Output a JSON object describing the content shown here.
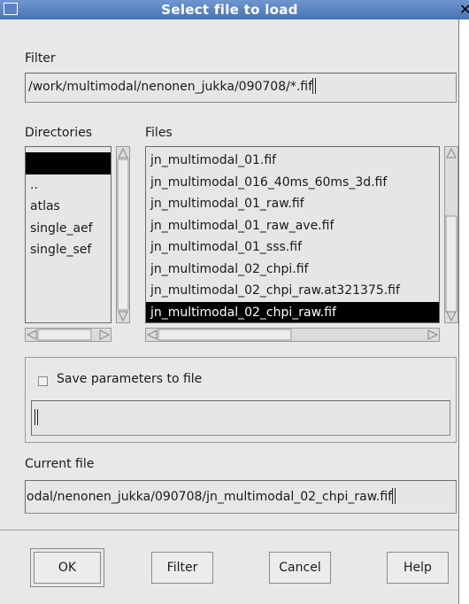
{
  "window": {
    "title": "Select file to load",
    "close_glyph": "✕"
  },
  "filter": {
    "label": "Filter",
    "value": "/work/multimodal/nenonen_jukka/090708/*.fif"
  },
  "directories": {
    "label": "Directories",
    "items": [
      "",
      "..",
      "atlas",
      "single_aef",
      "single_sef"
    ],
    "selected_index": 0
  },
  "files": {
    "label": "Files",
    "items": [
      "jn_multimodal_01.fif",
      "jn_multimodal_016_40ms_60ms_3d.fif",
      "jn_multimodal_01_raw.fif",
      "jn_multimodal_01_raw_ave.fif",
      "jn_multimodal_01_sss.fif",
      "jn_multimodal_02_chpi.fif",
      "jn_multimodal_02_chpi_raw.at321375.fif",
      "jn_multimodal_02_chpi_raw.fif"
    ],
    "selected_index": 7
  },
  "save_params": {
    "label": "Save parameters to file",
    "checked": false,
    "value": ""
  },
  "current_file": {
    "label": "Current file",
    "value": "odal/nenonen_jukka/090708/jn_multimodal_02_chpi_raw.fif"
  },
  "buttons": {
    "ok": "OK",
    "filter": "Filter",
    "cancel": "Cancel",
    "help": "Help"
  },
  "icons": {
    "check": "checkbox-icon",
    "arrows": "scroll-arrow-icon"
  }
}
